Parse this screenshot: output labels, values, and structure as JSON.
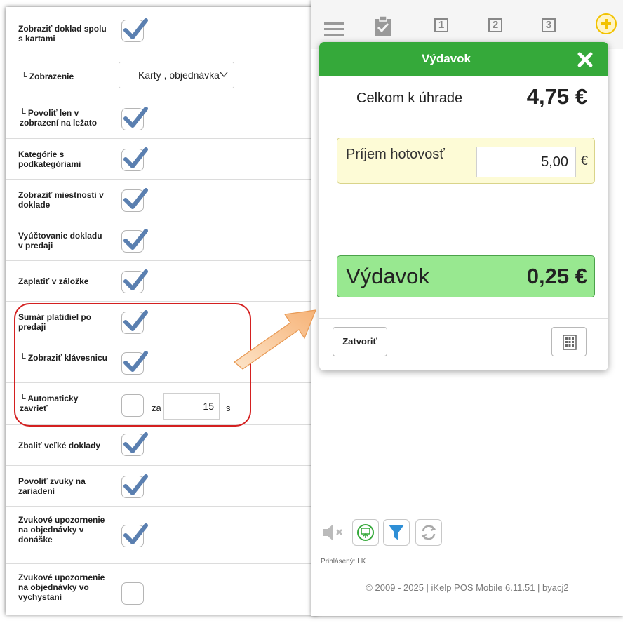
{
  "settings": {
    "rows": [
      {
        "label": "Zobraziť doklad spolu s kartami",
        "checked": true
      },
      {
        "label": "└ Zobrazenie",
        "select": "Karty , objednávka"
      },
      {
        "label": "└ Povoliť len v zobrazení na ležato",
        "checked": true
      },
      {
        "label": "Kategórie s podkategóriami",
        "checked": true
      },
      {
        "label": "Zobraziť miestnosti v doklade",
        "checked": true
      },
      {
        "label": "Vyúčtovanie dokladu v predaji",
        "checked": true
      },
      {
        "label": "Zaplatiť v záložke",
        "checked": true
      },
      {
        "label": "Sumár platidiel po predaji",
        "checked": true
      },
      {
        "label": "└ Zobraziť klávesnicu",
        "checked": true
      },
      {
        "label": "└ Automaticky zavrieť",
        "checked": false,
        "prefix": "za",
        "value": "15",
        "unit": "s"
      },
      {
        "label": "Zbaliť veľké doklady",
        "checked": true
      },
      {
        "label": "Povoliť zvuky na zariadení",
        "checked": true
      },
      {
        "label": "Zvukové upozornenie na objednávky v donáške",
        "checked": true
      },
      {
        "label": "Zvukové upozornenie na objednávky vo vychystaní",
        "checked": false
      }
    ]
  },
  "topbar": {
    "steps": [
      "1",
      "2",
      "3"
    ]
  },
  "modal": {
    "title": "Výdavok",
    "total_label": "Celkom k úhrade",
    "total_value": "4,75 €",
    "cash_label": "Príjem hotovosť",
    "cash_value": "5,00",
    "cash_currency": "€",
    "change_label": "Výdavok",
    "change_value": "0,25 €",
    "close_label": "Zatvoriť"
  },
  "footer": {
    "logged_in": "Prihlásený: LK",
    "copyright": "© 2009 - 2025 | iKelp POS Mobile 6.11.51 | byacj2"
  },
  "colors": {
    "header_green": "#35a93a",
    "change_green": "#98e890",
    "cash_yellow": "#fdfbd6",
    "highlight_red": "#d42020",
    "check_blue": "#5a7fb0"
  }
}
